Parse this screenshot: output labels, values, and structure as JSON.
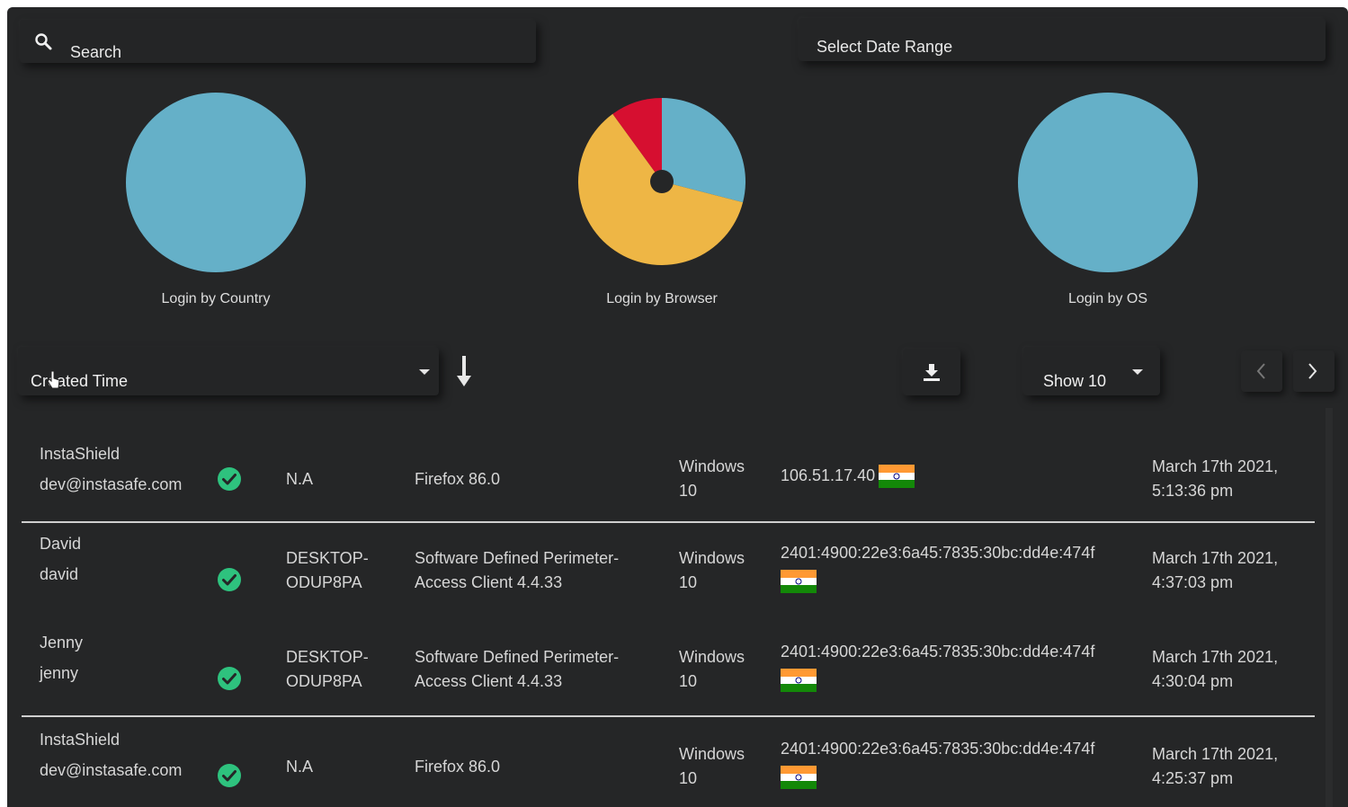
{
  "search": {
    "placeholder": "Search"
  },
  "date_range": {
    "placeholder": "Select Date Range"
  },
  "charts": {
    "country": {
      "label": "Login by Country"
    },
    "browser": {
      "label": "Login by Browser"
    },
    "os": {
      "label": "Login by OS"
    }
  },
  "chart_data": [
    {
      "type": "pie",
      "title": "Login by Country",
      "slices": [
        {
          "value": 100,
          "color": "#65b0c8"
        }
      ]
    },
    {
      "type": "pie",
      "title": "Login by Browser",
      "slices": [
        {
          "value": 29,
          "color": "#65b0c8"
        },
        {
          "value": 61,
          "color": "#eeb645"
        },
        {
          "value": 10,
          "color": "#d60f30"
        }
      ]
    },
    {
      "type": "pie",
      "title": "Login by OS",
      "slices": [
        {
          "value": 100,
          "color": "#65b0c8"
        }
      ]
    }
  ],
  "toolbar": {
    "sort_field": "Created Time",
    "page_size": "Show 10"
  },
  "icons": {
    "search": "search-icon",
    "sort": "arrow-down-icon",
    "download": "download-icon",
    "prev": "chevron-left-icon",
    "next": "chevron-right-icon",
    "status": "check-circle-icon",
    "flag": "india-flag-icon"
  },
  "colors": {
    "background": "#252627",
    "success": "#2ec27e",
    "pie_blue": "#65b0c8",
    "pie_yellow": "#eeb645",
    "pie_red": "#d60f30"
  },
  "rows": [
    {
      "name": "InstaShield",
      "username": "dev@instasafe.com",
      "host": "N.A",
      "host2": "",
      "client": "Firefox 86.0",
      "client2": "",
      "os": "Windows",
      "os2": "10",
      "ip": "106.51.17.40",
      "time": "March 17th 2021,",
      "time2": "5:13:36 pm"
    },
    {
      "name": "David",
      "username": "david",
      "host": "DESKTOP-",
      "host2": "ODUP8PA",
      "client": "Software Defined Perimeter-",
      "client2": "Access Client 4.4.33",
      "os": "Windows",
      "os2": "10",
      "ip": "2401:4900:22e3:6a45:7835:30bc:dd4e:474f",
      "time": "March 17th 2021,",
      "time2": "4:37:03 pm"
    },
    {
      "name": "Jenny",
      "username": "jenny",
      "host": "DESKTOP-",
      "host2": "ODUP8PA",
      "client": "Software Defined Perimeter-",
      "client2": "Access Client 4.4.33",
      "os": "Windows",
      "os2": "10",
      "ip": "2401:4900:22e3:6a45:7835:30bc:dd4e:474f",
      "time": "March 17th 2021,",
      "time2": "4:30:04 pm"
    },
    {
      "name": "InstaShield",
      "username": "dev@instasafe.com",
      "host": "N.A",
      "host2": "",
      "client": "Firefox 86.0",
      "client2": "",
      "os": "Windows",
      "os2": "10",
      "ip": "2401:4900:22e3:6a45:7835:30bc:dd4e:474f",
      "time": "March 17th 2021,",
      "time2": "4:25:37 pm"
    }
  ]
}
